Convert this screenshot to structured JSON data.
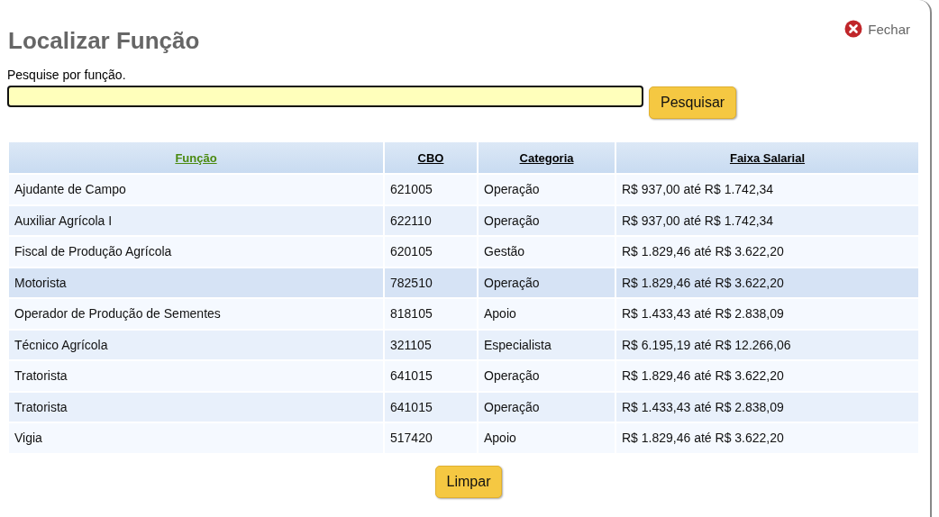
{
  "title": "Localizar Função",
  "close": {
    "label": "Fechar"
  },
  "search": {
    "label": "Pesquise por função.",
    "button": "Pesquisar"
  },
  "table": {
    "columns": [
      {
        "label": "Função",
        "sorted": true
      },
      {
        "label": "CBO",
        "sorted": false
      },
      {
        "label": "Categoria",
        "sorted": false
      },
      {
        "label": "Faixa Salarial",
        "sorted": false
      }
    ],
    "rows": [
      {
        "cells": [
          "Ajudante de Campo",
          "621005",
          "Operação",
          "R$ 937,00 até R$ 1.742,34"
        ],
        "selected": false
      },
      {
        "cells": [
          "Auxiliar Agrícola I",
          "622110",
          "Operação",
          "R$ 937,00 até R$ 1.742,34"
        ],
        "selected": false
      },
      {
        "cells": [
          "Fiscal de Produção Agrícola",
          "620105",
          "Gestão",
          "R$ 1.829,46 até R$ 3.622,20"
        ],
        "selected": false
      },
      {
        "cells": [
          "Motorista",
          "782510",
          "Operação",
          "R$ 1.829,46 até R$ 3.622,20"
        ],
        "selected": true
      },
      {
        "cells": [
          "Operador de Produção de Sementes",
          "818105",
          "Apoio",
          "R$ 1.433,43 até R$ 2.838,09"
        ],
        "selected": false
      },
      {
        "cells": [
          "Técnico Agrícola",
          "321105",
          "Especialista",
          "R$ 6.195,19 até R$ 12.266,06"
        ],
        "selected": false
      },
      {
        "cells": [
          "Tratorista",
          "641015",
          "Operação",
          "R$ 1.829,46 até R$ 3.622,20"
        ],
        "selected": false
      },
      {
        "cells": [
          "Tratorista",
          "641015",
          "Operação",
          "R$ 1.433,43 até R$ 2.838,09"
        ],
        "selected": false
      },
      {
        "cells": [
          "Vigia",
          "517420",
          "Apoio",
          "R$ 1.829,46 até R$ 3.622,20"
        ],
        "selected": false
      }
    ]
  },
  "clear_button": "Limpar"
}
